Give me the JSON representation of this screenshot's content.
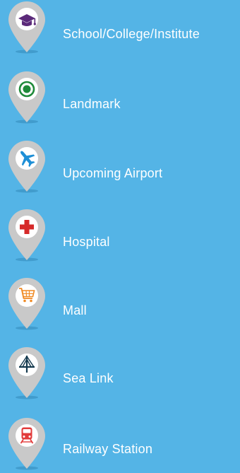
{
  "colors": {
    "background": "#54b4e6",
    "pin_fill": "#c9c9c9",
    "pin_inner": "#ffffff",
    "label": "#ffffff"
  },
  "legend": {
    "items": [
      {
        "label": "School/College/Institute",
        "icon": "graduation-cap-icon",
        "icon_color": "#5b2a7a"
      },
      {
        "label": "Landmark",
        "icon": "landmark-target-icon",
        "icon_color": "#1f8a3a"
      },
      {
        "label": "Upcoming Airport",
        "icon": "airplane-icon",
        "icon_color": "#1e8fd6"
      },
      {
        "label": "Hospital",
        "icon": "medical-cross-icon",
        "icon_color": "#d62a2a"
      },
      {
        "label": "Mall",
        "icon": "shopping-cart-icon",
        "icon_color": "#f08a24"
      },
      {
        "label": "Sea Link",
        "icon": "bridge-icon",
        "icon_color": "#153a4f"
      },
      {
        "label": "Railway Station",
        "icon": "train-icon",
        "icon_color": "#e23c3c"
      }
    ]
  }
}
